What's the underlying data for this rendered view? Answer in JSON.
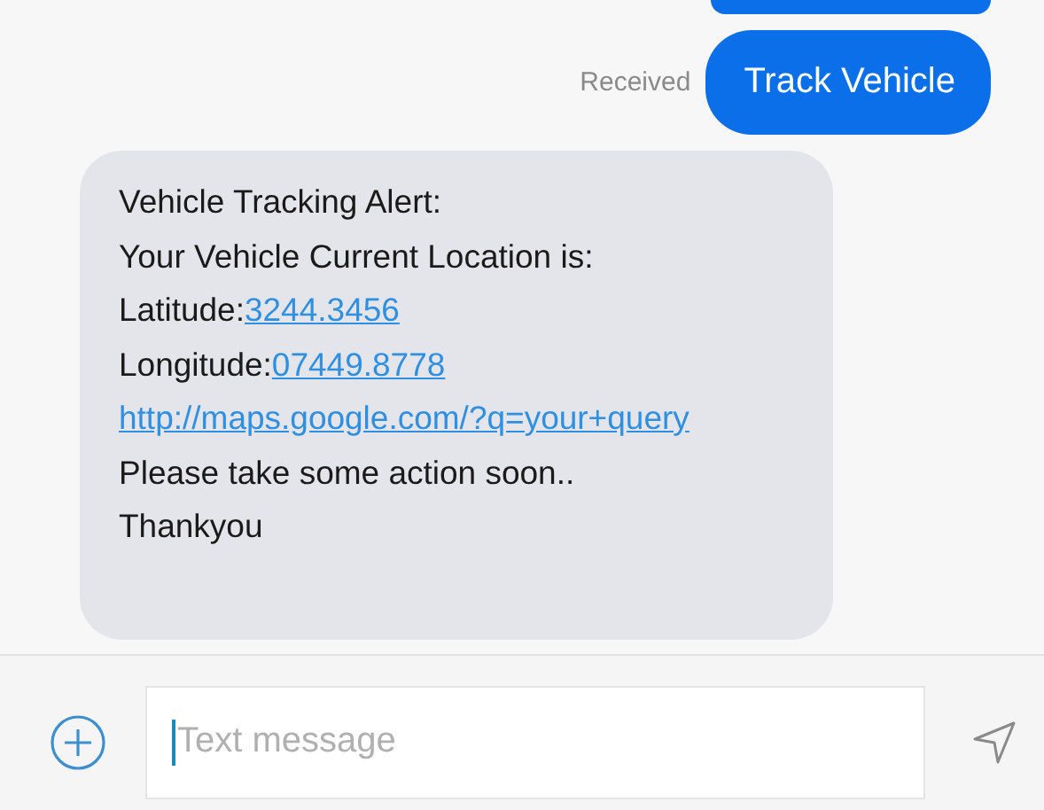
{
  "sent_messages": [
    {
      "status": "Received",
      "text": "Track Vehicle"
    }
  ],
  "received_message": {
    "lines": [
      {
        "parts": [
          {
            "kind": "text",
            "text": "Vehicle Tracking Alert:"
          }
        ]
      },
      {
        "parts": [
          {
            "kind": "text",
            "text": "Your Vehicle Current Location is:"
          }
        ]
      },
      {
        "parts": [
          {
            "kind": "text",
            "text": "Latitude:"
          },
          {
            "kind": "link",
            "text": "3244.3456"
          }
        ]
      },
      {
        "parts": [
          {
            "kind": "text",
            "text": "Longitude:"
          },
          {
            "kind": "link",
            "text": "07449.8778"
          }
        ]
      },
      {
        "parts": [
          {
            "kind": "link",
            "text": "http://maps.google.com/?q=your+query"
          }
        ]
      },
      {
        "parts": [
          {
            "kind": "text",
            "text": "Please take some action soon.."
          }
        ]
      },
      {
        "parts": [
          {
            "kind": "text",
            "text": "Thankyou"
          }
        ]
      }
    ]
  },
  "composer": {
    "placeholder": "Text message"
  }
}
